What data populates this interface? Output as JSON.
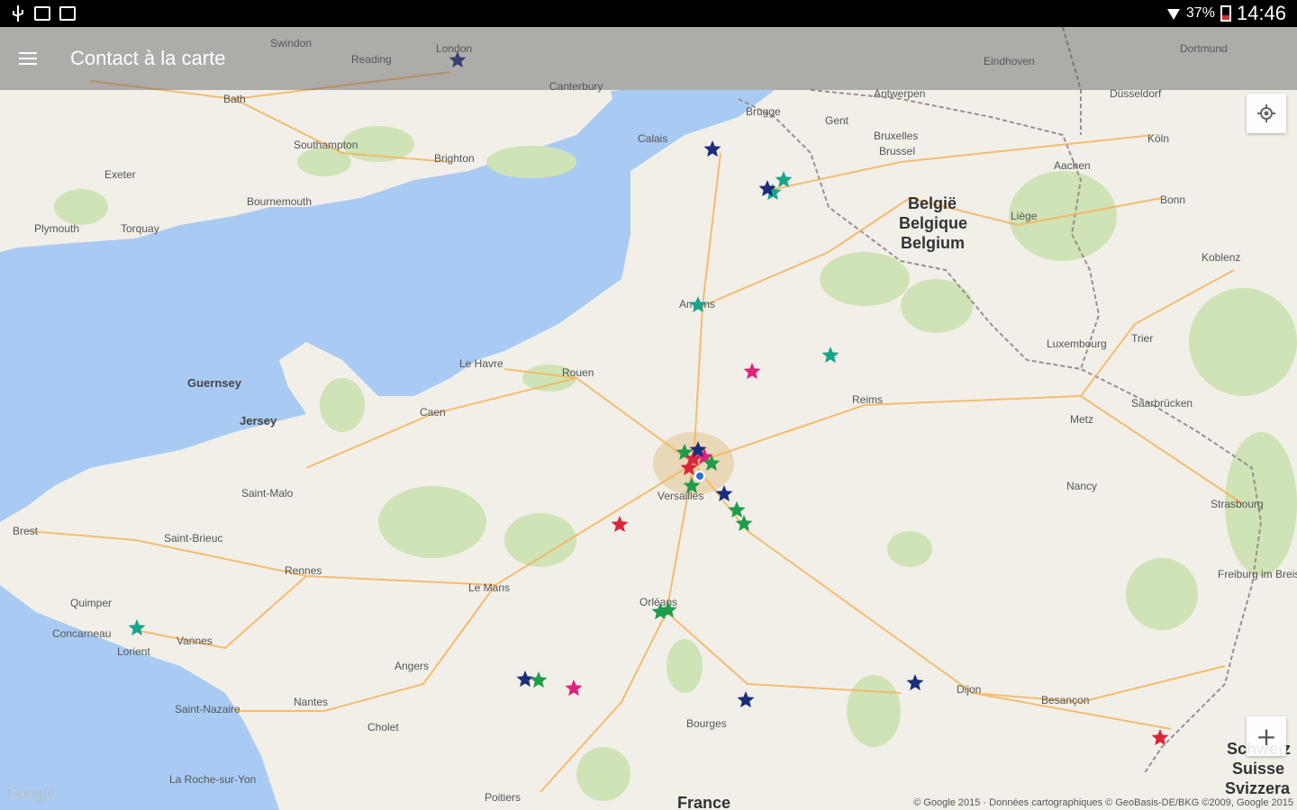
{
  "status_bar": {
    "battery": "37%",
    "time": "14:46"
  },
  "app_bar": {
    "title": "Contact à la carte"
  },
  "map": {
    "countries": [
      "België",
      "Belgique",
      "Belgium",
      "France",
      "Schweiz",
      "Suisse",
      "Svizzera"
    ],
    "islands": [
      "Guernsey",
      "Jersey"
    ],
    "cities": [
      "London",
      "Reading",
      "Swindon",
      "Bath",
      "Southampton",
      "Brighton",
      "Canterbury",
      "Exeter",
      "Bournemouth",
      "Plymouth",
      "Torquay",
      "Calais",
      "Brugge",
      "Gent",
      "Antwerpen",
      "Bruxelles",
      "Brussel",
      "Liège",
      "Amiens",
      "Rouen",
      "Le Havre",
      "Caen",
      "Reims",
      "Metz",
      "Nancy",
      "Strasbourg",
      "Rennes",
      "Le Mans",
      "Orléans",
      "Angers",
      "Nantes",
      "Dijon",
      "Besançon",
      "Bourges",
      "Quimper",
      "Lorient",
      "Vannes",
      "Brest",
      "Saint-Brieuc",
      "Saint-Malo",
      "Cholet",
      "Versailles",
      "Köln",
      "Bonn",
      "Düsseldorf",
      "Eindhoven",
      "Dortmund",
      "Aachen",
      "Koblenz",
      "Trier",
      "Luxembourg",
      "Saarbrücken",
      "Freiburg im Breisgau",
      "La Roche-sur-Yon",
      "Poitiers",
      "Saint-Nazaire",
      "Concarneau"
    ],
    "marker_colors": {
      "navy": "#1a2d7c",
      "teal": "#17a589",
      "green": "#1e9c4a",
      "pink": "#e0227a",
      "red": "#d9263a",
      "blue": "#2a6fd6"
    }
  },
  "controls": {
    "location_icon": "my-location-icon",
    "zoom_in_label": "+"
  },
  "footer": {
    "google_logo": "Google",
    "attribution": "© Google 2015 · Données cartographiques © GeoBasis-DE/BKG ©2009, Google 2015"
  }
}
